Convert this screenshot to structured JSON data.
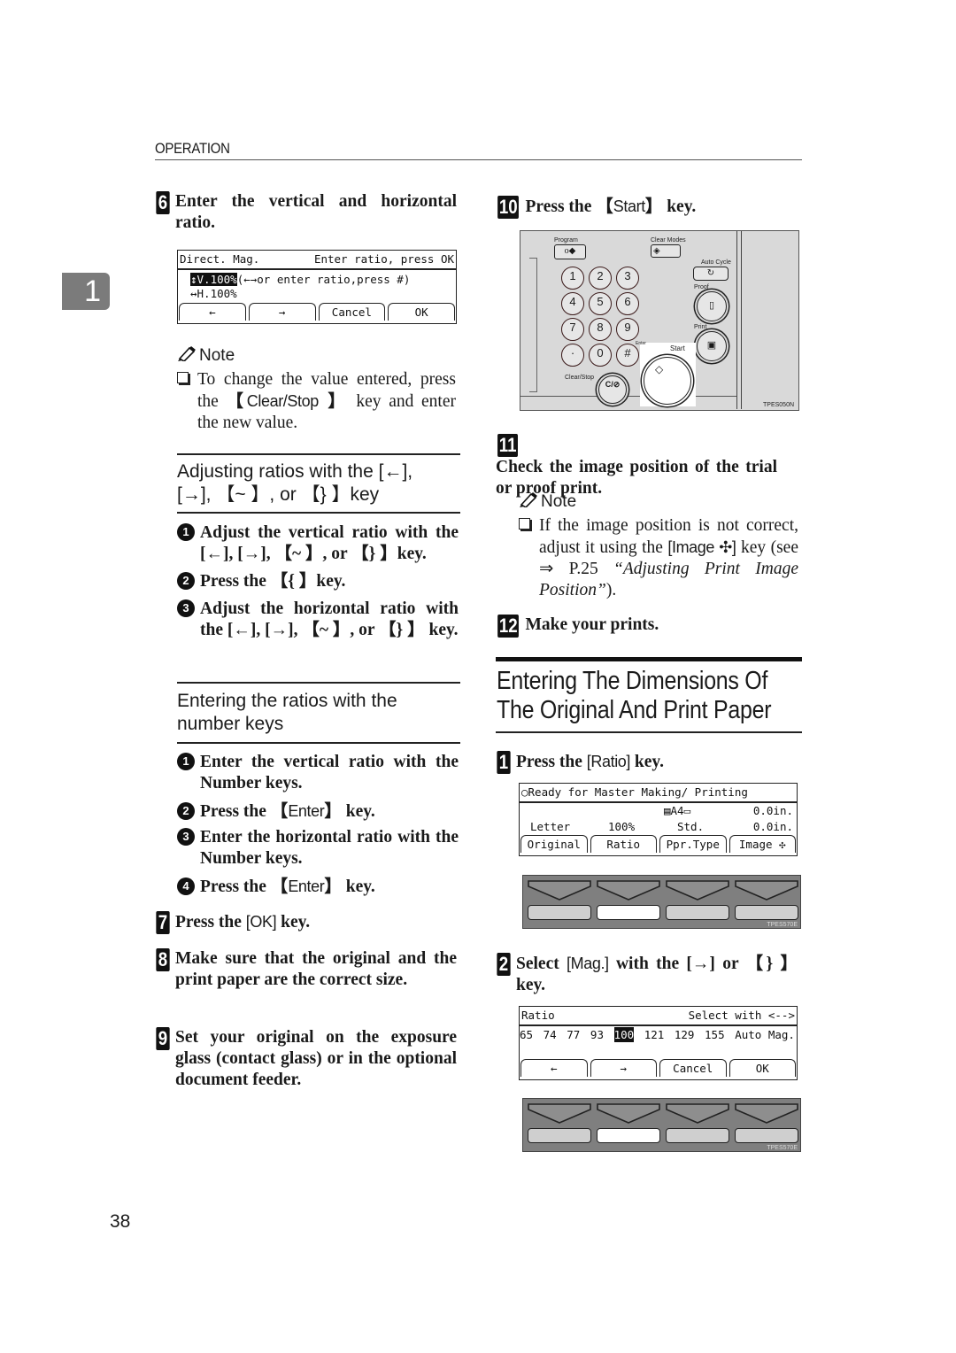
{
  "header": {
    "running_head": "OPERATION",
    "chapter_tab": "1",
    "page_number": "38"
  },
  "left_column": {
    "step6": {
      "number": "6",
      "text": "Enter the vertical and horizontal ratio."
    },
    "lcd_direct_mag": {
      "title_left": "Direct. Mag.",
      "title_right": "Enter ratio, press OK",
      "line1_highlight": "↕V.100%",
      "line1_rest": "(←→or enter ratio,press #)",
      "line2": "↔H.100%",
      "buttons": [
        "←",
        "→",
        "Cancel",
        "OK"
      ]
    },
    "note1": {
      "heading": "Note",
      "text_before": "To change the value entered, press the ",
      "key": "Clear/Stop",
      "text_after": " key and enter the new value."
    },
    "subsection1": {
      "title_line1": "Adjusting ratios with the [←],",
      "title_line2": "[→], 【~ 】, or 【} 】key",
      "items": [
        {
          "num": "1",
          "text": "Adjust the vertical ratio with the [←], [→], 【~ 】, or 【} 】key."
        },
        {
          "num": "2",
          "text": "Press the 【{ 】key."
        },
        {
          "num": "3",
          "text": "Adjust the horizontal ratio with the [←], [→], 【~ 】, or 【} 】 key."
        }
      ]
    },
    "subsection2": {
      "title_line1": "Entering the ratios with the",
      "title_line2": "number keys",
      "items": [
        {
          "num": "1",
          "text": "Enter the vertical ratio with the Number keys."
        },
        {
          "num": "2",
          "text_before": "Press the ",
          "key": "Enter",
          "text_after": " key."
        },
        {
          "num": "3",
          "text": "Enter the horizontal ratio with the Number keys."
        },
        {
          "num": "4",
          "text_before": "Press the ",
          "key": "Enter",
          "text_after": " key."
        }
      ]
    },
    "step7": {
      "number": "7",
      "text_before": "Press the ",
      "key": "[OK]",
      "text_after": " key."
    },
    "step8": {
      "number": "8",
      "text": "Make sure that the original and the print paper are the correct size."
    },
    "step9": {
      "number": "9",
      "text": "Set your original on the exposure glass (contact glass) or in the optional document feeder."
    }
  },
  "right_column": {
    "step10": {
      "number": "10",
      "text_before": "Press the ",
      "key": "Start",
      "text_after": " key."
    },
    "control_panel": {
      "labels": {
        "program": "Program",
        "clear_modes": "Clear Modes",
        "auto_cycle": "Auto Cycle",
        "proof": "Proof",
        "print": "Print",
        "enter": "Enter",
        "start": "Start",
        "clear_stop": "Clear/Stop",
        "clear_stop_key": "C/⊘"
      },
      "number_keys": [
        "1",
        "2",
        "3",
        "4",
        "5",
        "6",
        "7",
        "8",
        "9",
        "·",
        "0",
        "#"
      ],
      "figure_code": "TPES050N"
    },
    "step11": {
      "number": "11",
      "text": "Check the image position of the trial or proof print."
    },
    "note2": {
      "heading": "Note",
      "text_before": "If the image position is not correct, adjust it using the ",
      "key": "[Image ✣]",
      "text_mid": " key (see ⇒ P.25 ",
      "ref": "“Adjusting Print Image Position”",
      "text_after": ")."
    },
    "step12": {
      "number": "12",
      "text": "Make your prints."
    },
    "section": {
      "title_line1": "Entering The Dimensions Of",
      "title_line2": "The Original And Print Paper"
    },
    "stepA1": {
      "number": "1",
      "text_before": "Press the ",
      "key": "[Ratio]",
      "text_after": " key."
    },
    "lcd_ready": {
      "status": "○Ready for Master Making/ Printing",
      "row1_paper": "▤A4▭",
      "row1_value": "0.0in.",
      "row2_original": "Letter",
      "row2_ratio": "100%",
      "row2_type": "Std.",
      "row2_value": "0.0in.",
      "buttons": [
        "Original",
        "Ratio",
        "Ppr.Type",
        "Image ✣"
      ]
    },
    "softkeys1": {
      "figure_code": "TPES570E",
      "selected_index": 2
    },
    "stepA2": {
      "number": "2",
      "text_before": "Select ",
      "key": "[Mag.]",
      "text_mid": " with the [→] or ",
      "key2": "【} 】",
      "text_after": " key."
    },
    "lcd_ratio": {
      "title_left": "Ratio",
      "title_right": "Select with <-->",
      "values": [
        "65",
        "74",
        "77",
        "93",
        "100",
        "121",
        "129",
        "155",
        "Auto Mag."
      ],
      "selected": "100",
      "buttons": [
        "←",
        "→",
        "Cancel",
        "OK"
      ]
    },
    "softkeys2": {
      "figure_code": "TPES570E",
      "selected_index": 2
    }
  }
}
